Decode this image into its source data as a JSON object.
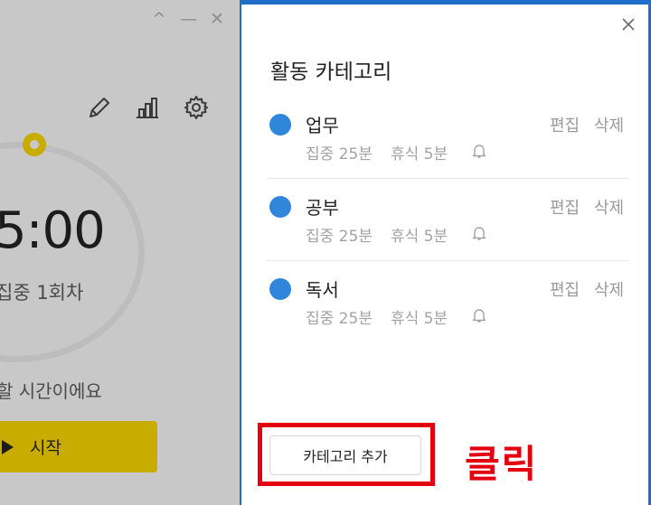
{
  "timer_window": {
    "controls": [
      "^",
      "—",
      "✕"
    ],
    "tools": [
      "pencil-icon",
      "bar-chart-icon",
      "gear-icon"
    ],
    "time": "5:00",
    "session": "집중 1회차",
    "hint": "할 시간이에요",
    "start_label": "시작"
  },
  "panel": {
    "title": "활동 카테고리",
    "categories": [
      {
        "name": "업무",
        "edit": "편집",
        "delete": "삭제",
        "focus": "집중 25분",
        "rest": "휴식 5분",
        "color": "#2f86db"
      },
      {
        "name": "공부",
        "edit": "편집",
        "delete": "삭제",
        "focus": "집중 25분",
        "rest": "휴식 5분",
        "color": "#2f86db"
      },
      {
        "name": "독서",
        "edit": "편집",
        "delete": "삭제",
        "focus": "집중 25분",
        "rest": "휴식 5분",
        "color": "#2f86db"
      }
    ],
    "add_label": "카테고리 추가"
  },
  "annotation": {
    "text": "클릭",
    "color": "#e3000f"
  },
  "colors": {
    "accent": "#c8ad00",
    "category_dot": "#2f86db",
    "desktop": "#1f6fc8"
  }
}
